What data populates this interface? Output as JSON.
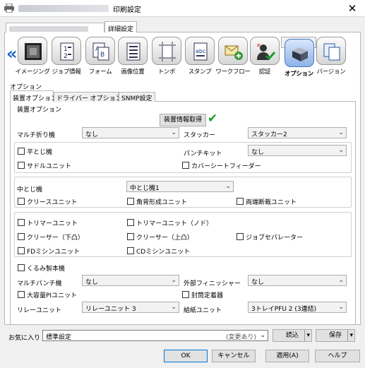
{
  "window": {
    "title": "印刷設定",
    "close_glyph": "✕",
    "icon": "printer-icon"
  },
  "top_tabs": [
    {
      "label": ""
    },
    {
      "label": "詳細設定"
    }
  ],
  "nav": {
    "left_arrow": "«",
    "items": [
      "イメージング",
      "ジョブ情報",
      "フォーム",
      "画像位置",
      "トンボ",
      "スタンプ",
      "ワークフロー",
      "認証",
      "オプション",
      "バージョン"
    ],
    "selected": "オプション"
  },
  "section_label": "オプション",
  "sub_tabs": [
    "装置オプション",
    "ドライバー オプション",
    "SNMP設定"
  ],
  "group_label": "装置オプション",
  "acquire_button": "装置情報取得",
  "fields": {
    "multi_fold_label": "マルチ折り機",
    "multi_fold_value": "なし",
    "stacker_label": "スタッカー",
    "stacker_value": "スタッカー2",
    "punch_kit_label": "パンチキット",
    "punch_kit_value": "なし",
    "saddle_stitch_label": "中とじ機",
    "saddle_stitch_value": "中とじ機1",
    "multi_punch_label": "マルチパンチ機",
    "multi_punch_value": "なし",
    "ext_finisher_label": "外部フィニッシャー",
    "ext_finisher_value": "なし",
    "relay_unit_label": "リレーユニット",
    "relay_unit_value": "リレーユニット 3",
    "feed_unit_label": "給紙ユニット",
    "feed_unit_value": "3トレイPFU 2 (3連結)"
  },
  "checkboxes": {
    "flat_stitch": "平とじ機",
    "saddle_unit": "サドルユニット",
    "cover_feeder": "カバーシートフィーダー",
    "crease_unit": "クリースユニット",
    "square_fold": "角背形成ユニット",
    "trim_both": "両端断裁ユニット",
    "trimmer": "トリマーユニット",
    "trimmer_node": "トリマーユニット（ノド）",
    "job_sep": "ジョブセパレーター",
    "creaser_down": "クリーサー（下凸）",
    "creaser_up": "クリーサー（上凸）",
    "fd_sewing": "FDミシンユニット",
    "cd_sewing": "CDミシンユニット",
    "perfect_binder": "くるみ製本機",
    "large_pi": "大容量PIユニット",
    "seal_device": "封筒定着器"
  },
  "favorites": {
    "label": "お気に入り",
    "value": "標準設定",
    "changed": "(変更あり)",
    "load": "読込",
    "save": "保存"
  },
  "footer": {
    "ok": "OK",
    "cancel": "キャンセル",
    "apply": "適用(A)",
    "help": "ヘルプ"
  },
  "colors": {
    "accent": "#0078d7",
    "check": "#1a9a2a",
    "nav_arrow": "#1e64c8"
  }
}
